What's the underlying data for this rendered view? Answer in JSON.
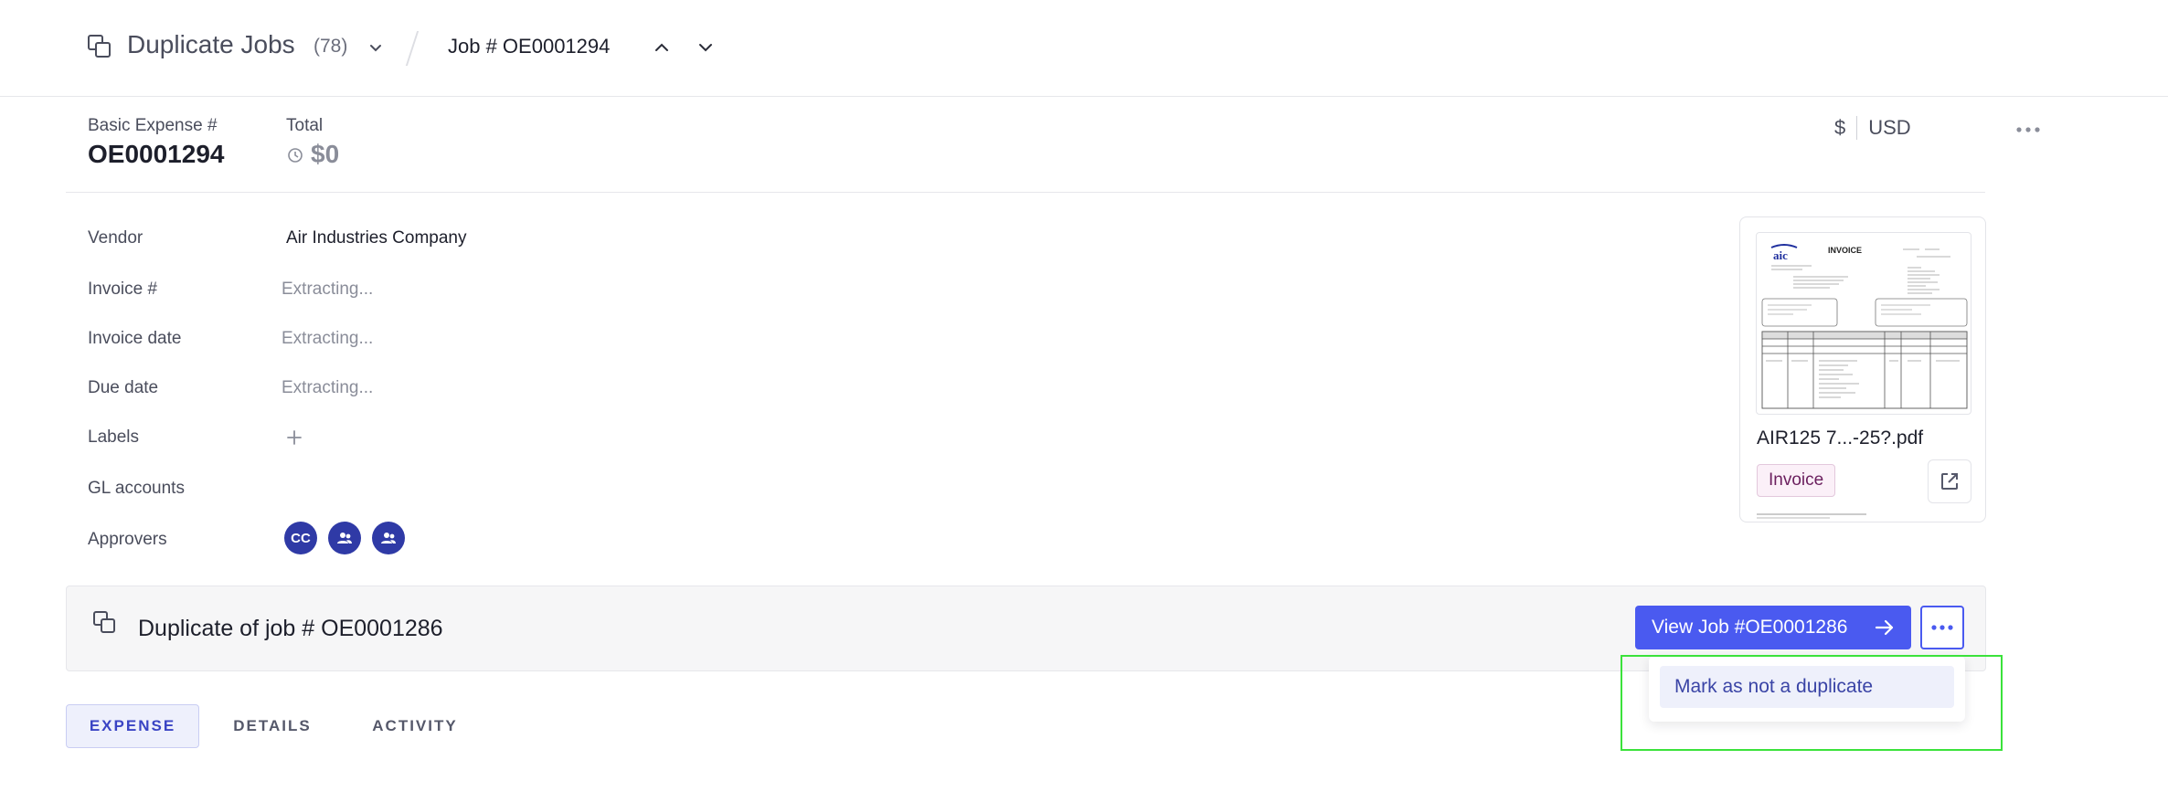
{
  "header": {
    "section_title": "Duplicate Jobs",
    "count": "(78)",
    "job_label": "Job # OE0001294"
  },
  "summary": {
    "expense_label": "Basic Expense #",
    "expense_number": "OE0001294",
    "total_label": "Total",
    "total_value": "$0",
    "currency_symbol": "$",
    "currency_code": "USD"
  },
  "fields": {
    "vendor_label": "Vendor",
    "vendor_value": "Air Industries Company",
    "invoice_num_label": "Invoice #",
    "invoice_num_value": "Extracting...",
    "invoice_date_label": "Invoice date",
    "invoice_date_value": "Extracting...",
    "due_date_label": "Due date",
    "due_date_value": "Extracting...",
    "labels_label": "Labels",
    "gl_accounts_label": "GL accounts",
    "approvers_label": "Approvers",
    "approvers": [
      "CC"
    ]
  },
  "document": {
    "file_name": "AIR125 7...-25?.pdf",
    "badge": "Invoice"
  },
  "duplicate_banner": {
    "text": "Duplicate of job # OE0001286",
    "view_button": "View Job #OE0001286"
  },
  "menu": {
    "mark_not_duplicate": "Mark as not a duplicate"
  },
  "tabs": {
    "expense": "EXPENSE",
    "details": "DETAILS",
    "activity": "ACTIVITY"
  }
}
